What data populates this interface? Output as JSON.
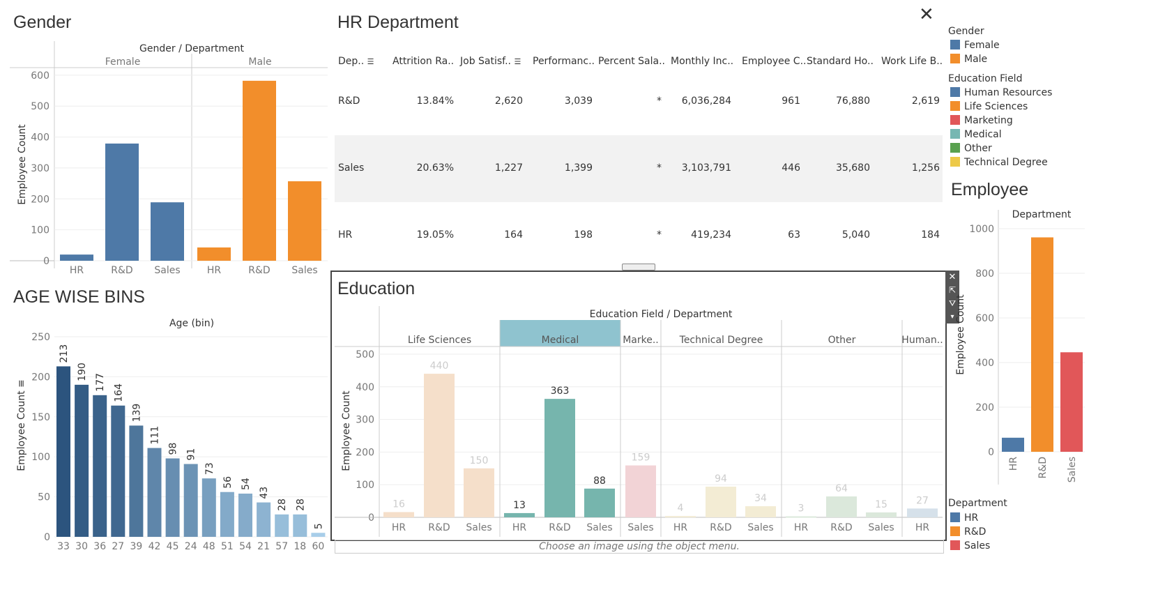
{
  "colors": {
    "female": "#4e79a7",
    "male": "#f28e2b",
    "hr_dept": "#4e79a7",
    "rnd_dept": "#f28e2b",
    "sales_dept": "#e15759",
    "grid": "#eeeeee",
    "sel": "#8fc3cf"
  },
  "gender_section": {
    "title": "Gender",
    "header": "Gender / Department",
    "groups": [
      "Female",
      "Male"
    ],
    "ylabel": "Employee Count",
    "yticks": [
      "0",
      "100",
      "200",
      "300",
      "400",
      "500",
      "600"
    ]
  },
  "hr_section": {
    "title": "HR Department",
    "columns": [
      "Dep..",
      "Attrition Ra..",
      "Job Satisf..",
      "Performanc..",
      "Percent Sala..",
      "Monthly Inc..",
      "Employee C..",
      "Standard Ho..",
      "Work Life B.."
    ],
    "rows": [
      {
        "dept": "R&D",
        "attrition": "13.84%",
        "job_sat": "2,620",
        "performance": "3,039",
        "percent_salary": "*",
        "monthly_income": "6,036,284",
        "employee_count": "961",
        "standard_hours": "76,880",
        "work_life": "2,619"
      },
      {
        "dept": "Sales",
        "attrition": "20.63%",
        "job_sat": "1,227",
        "performance": "1,399",
        "percent_salary": "*",
        "monthly_income": "3,103,791",
        "employee_count": "446",
        "standard_hours": "35,680",
        "work_life": "1,256"
      },
      {
        "dept": "HR",
        "attrition": "19.05%",
        "job_sat": "164",
        "performance": "198",
        "percent_salary": "*",
        "monthly_income": "419,234",
        "employee_count": "63",
        "standard_hours": "5,040",
        "work_life": "184"
      }
    ]
  },
  "age_section": {
    "title": "AGE WISE BINS",
    "header": "Age (bin)",
    "ylabel": "Employee Count",
    "yticks": [
      "0",
      "50",
      "100",
      "150",
      "200",
      "250"
    ]
  },
  "education_section": {
    "title": "Education",
    "header": "Education Field / Department",
    "fields": [
      "Life Sciences",
      "Medical",
      "Marke..",
      "Technical Degree",
      "Other",
      "Human.."
    ],
    "ylabel": "Employee Count",
    "yticks": [
      "0",
      "100",
      "200",
      "300",
      "400",
      "500"
    ],
    "footer": "Choose an image using the object menu."
  },
  "legends": {
    "gender_title": "Gender",
    "gender": [
      {
        "label": "Female",
        "color": "#4e79a7"
      },
      {
        "label": "Male",
        "color": "#f28e2b"
      }
    ],
    "edu_title": "Education Field",
    "edu": [
      {
        "label": "Human Resources",
        "color": "#4e79a7"
      },
      {
        "label": "Life Sciences",
        "color": "#f28e2b"
      },
      {
        "label": "Marketing",
        "color": "#e15759"
      },
      {
        "label": "Medical",
        "color": "#76b7b2"
      },
      {
        "label": "Other",
        "color": "#59a14f"
      },
      {
        "label": "Technical Degree",
        "color": "#edc948"
      }
    ],
    "dept_title": "Department",
    "dept": [
      {
        "label": "HR",
        "color": "#4e79a7"
      },
      {
        "label": "R&D",
        "color": "#f28e2b"
      },
      {
        "label": "Sales",
        "color": "#e15759"
      }
    ]
  },
  "employee_section": {
    "title": "Employee",
    "header": "Department",
    "ylabel": "Employee Count",
    "yticks": [
      "0",
      "200",
      "400",
      "600",
      "800",
      "1000"
    ]
  },
  "chart_data": [
    {
      "type": "bar",
      "title": "Gender",
      "header": "Gender / Department",
      "ylabel": "Employee Count",
      "ylim": [
        0,
        600
      ],
      "categories": [
        "HR",
        "R&D",
        "Sales"
      ],
      "series": [
        {
          "name": "Female",
          "values": [
            20,
            379,
            189
          ]
        },
        {
          "name": "Male",
          "values": [
            43,
            582,
            257
          ]
        }
      ]
    },
    {
      "type": "bar",
      "title": "AGE WISE BINS",
      "header": "Age (bin)",
      "ylabel": "Employee Count",
      "ylim": [
        0,
        250
      ],
      "categories": [
        "33",
        "30",
        "36",
        "27",
        "39",
        "42",
        "45",
        "24",
        "48",
        "51",
        "54",
        "21",
        "57",
        "18",
        "60"
      ],
      "values": [
        213,
        190,
        177,
        164,
        139,
        111,
        98,
        91,
        73,
        56,
        54,
        43,
        28,
        28,
        5
      ]
    },
    {
      "type": "bar",
      "title": "Education",
      "header": "Education Field / Department",
      "ylabel": "Employee Count",
      "ylim": [
        0,
        500
      ],
      "groups": [
        {
          "field": "Life Sciences",
          "categories": [
            "HR",
            "R&D",
            "Sales"
          ],
          "values": [
            16,
            440,
            150
          ]
        },
        {
          "field": "Medical",
          "categories": [
            "HR",
            "R&D",
            "Sales"
          ],
          "values": [
            13,
            363,
            88
          ]
        },
        {
          "field": "Marke..",
          "categories": [
            "Sales"
          ],
          "values": [
            159
          ]
        },
        {
          "field": "Technical Degree",
          "categories": [
            "HR",
            "R&D",
            "Sales"
          ],
          "values": [
            4,
            94,
            34
          ]
        },
        {
          "field": "Other",
          "categories": [
            "HR",
            "R&D",
            "Sales"
          ],
          "values": [
            3,
            64,
            15
          ]
        },
        {
          "field": "Human..",
          "categories": [
            "HR"
          ],
          "values": [
            27
          ]
        }
      ]
    },
    {
      "type": "bar",
      "title": "Employee",
      "header": "Department",
      "ylabel": "Employee Count",
      "ylim": [
        0,
        1000
      ],
      "categories": [
        "HR",
        "R&D",
        "Sales"
      ],
      "values": [
        63,
        961,
        446
      ]
    }
  ]
}
